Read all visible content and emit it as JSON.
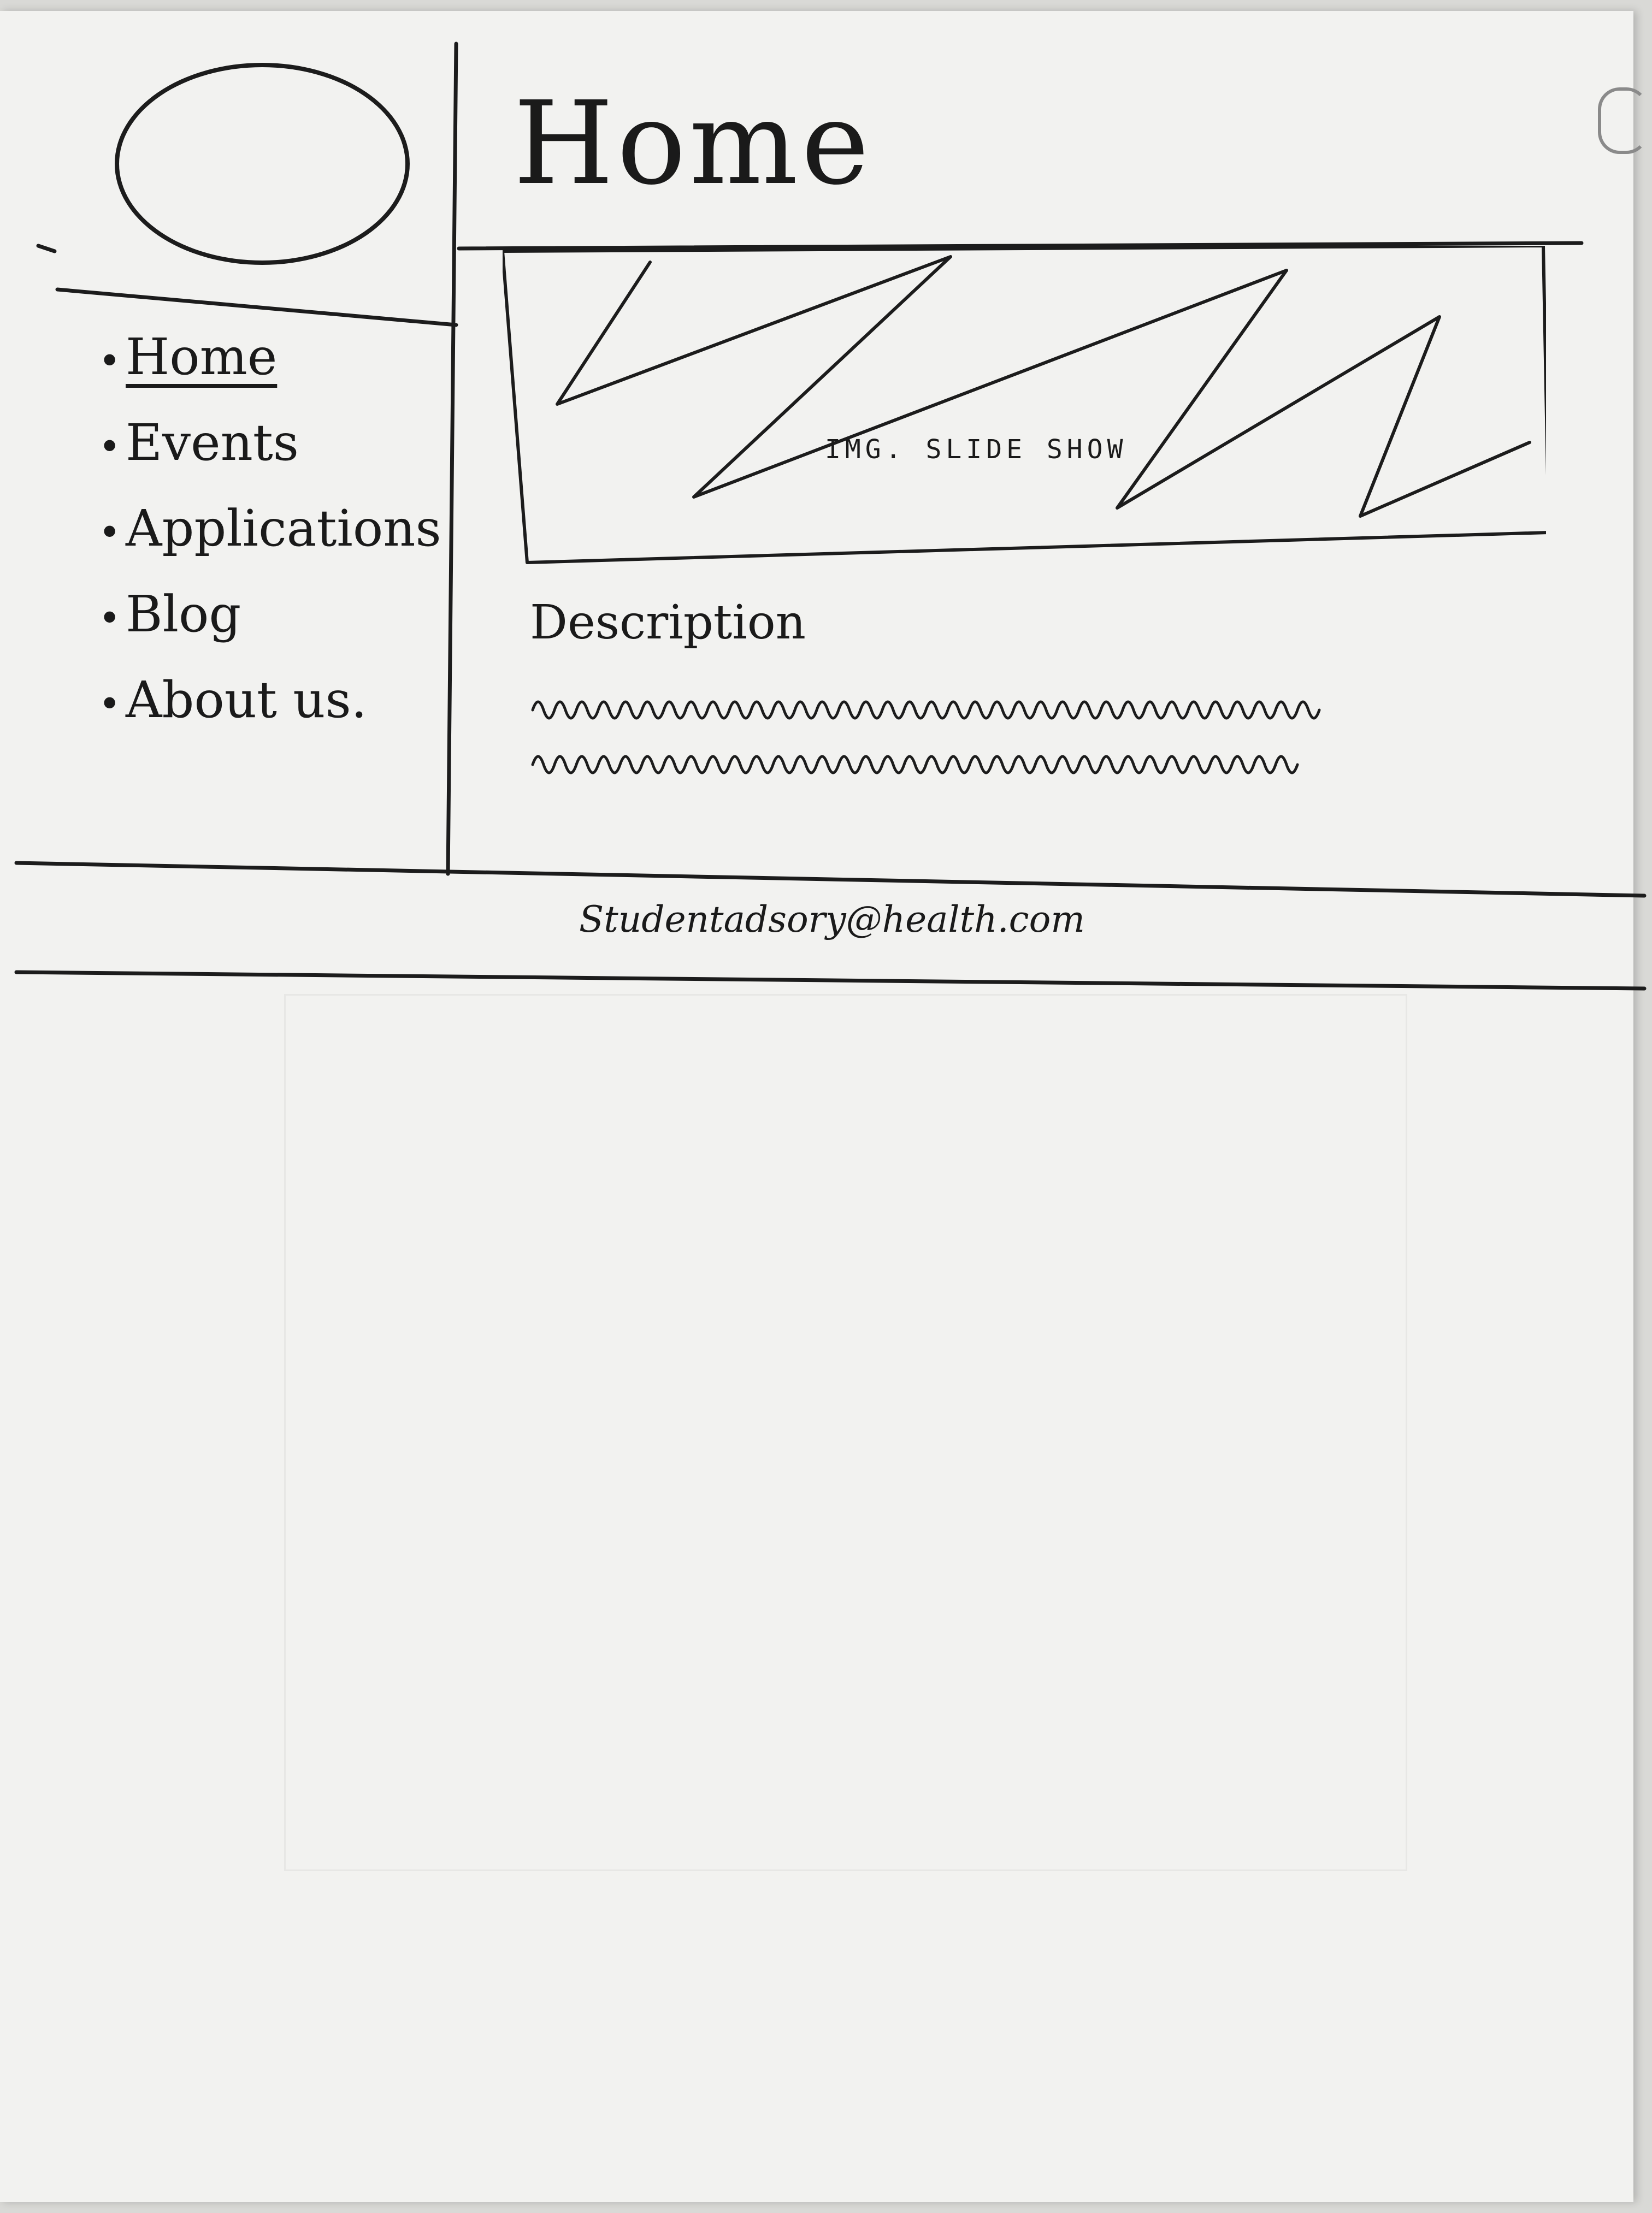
{
  "header": {
    "title": "Home"
  },
  "sidebar": {
    "items": [
      {
        "label": "Home",
        "active": true
      },
      {
        "label": "Events"
      },
      {
        "label": "Applications"
      },
      {
        "label": "Blog"
      },
      {
        "label": "About us."
      }
    ]
  },
  "main": {
    "slideshow_label": "IMG. SLIDE SHOW",
    "description_heading": "Description"
  },
  "footer": {
    "email": "Studentadsory@health.com"
  },
  "icons": {
    "logo": "logo-placeholder-icon",
    "bullet": "bullet-icon"
  }
}
